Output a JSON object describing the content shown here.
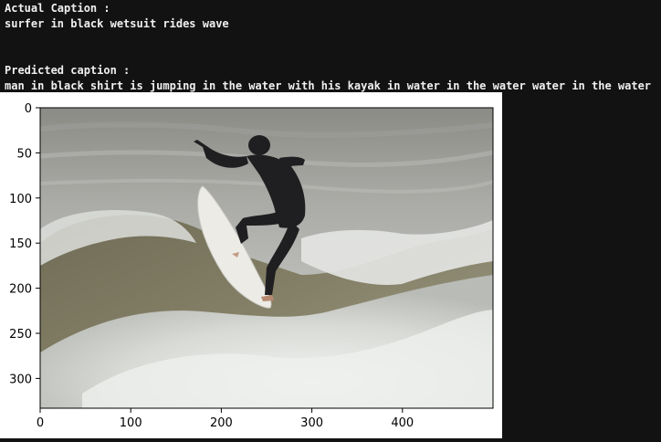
{
  "output": {
    "actual_heading": "Actual Caption :",
    "actual_caption": "surfer in black wetsuit rides wave",
    "predicted_heading": "Predicted caption :",
    "predicted_caption": "man in black shirt is jumping in the water with his kayak in water in the water water in the water"
  },
  "plot": {
    "image_subject": "surfer in black wetsuit riding a wave on a white surfboard",
    "x_ticks": [
      0,
      100,
      200,
      300,
      400
    ],
    "y_ticks": [
      0,
      50,
      100,
      150,
      200,
      250,
      300
    ],
    "x_range": [
      0,
      500
    ],
    "y_range": [
      0,
      333
    ]
  }
}
